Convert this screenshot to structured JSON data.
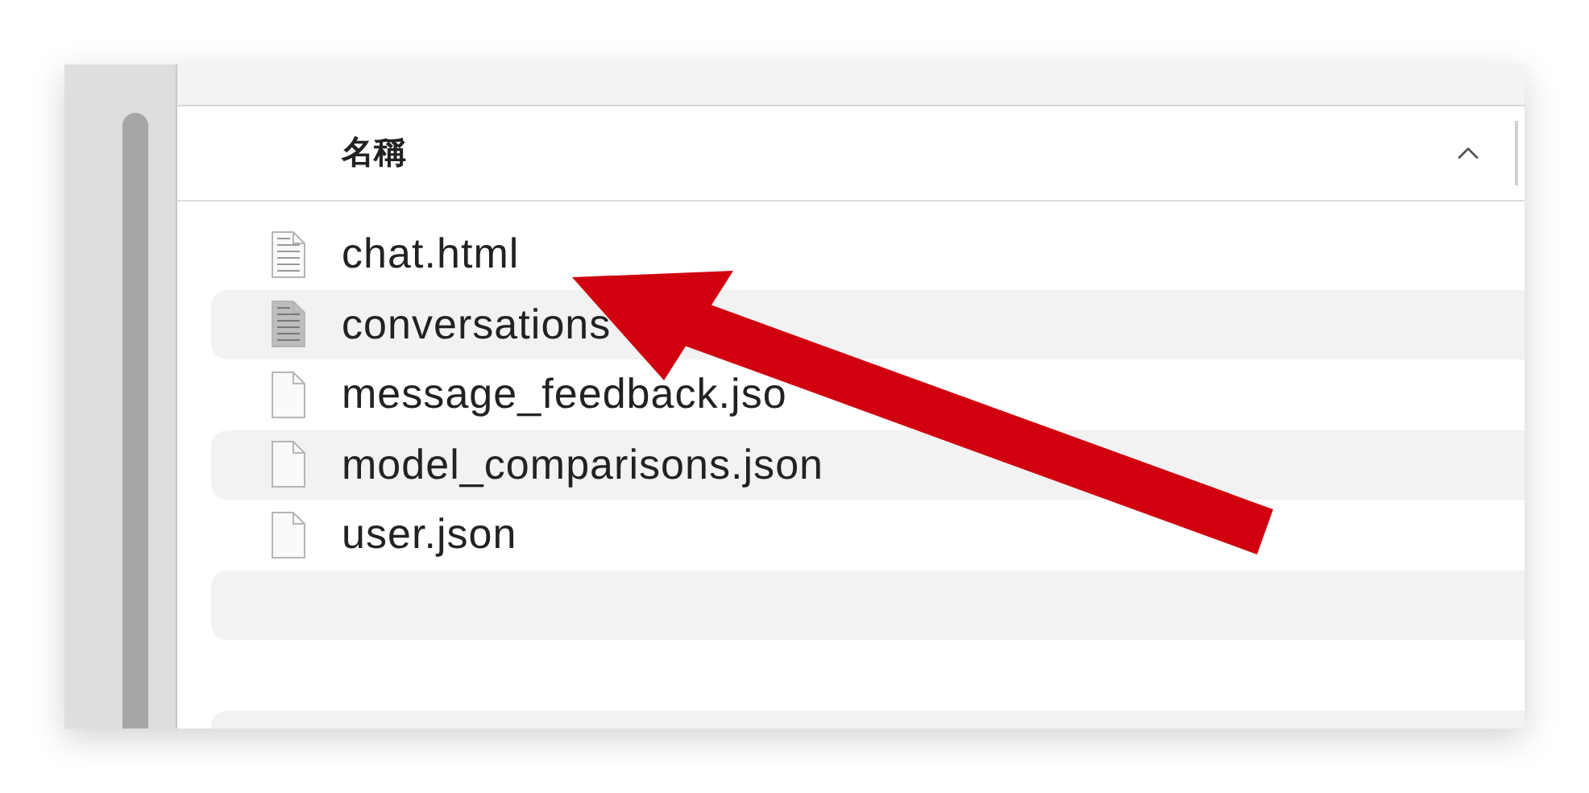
{
  "column_header": {
    "label": "名稱"
  },
  "files": [
    {
      "name": "chat.html",
      "kind": "html"
    },
    {
      "name": "conversations",
      "kind": "text"
    },
    {
      "name": "message_feedback.jso",
      "kind": "plain"
    },
    {
      "name": "model_comparisons.json",
      "kind": "plain"
    },
    {
      "name": "user.json",
      "kind": "plain"
    }
  ]
}
